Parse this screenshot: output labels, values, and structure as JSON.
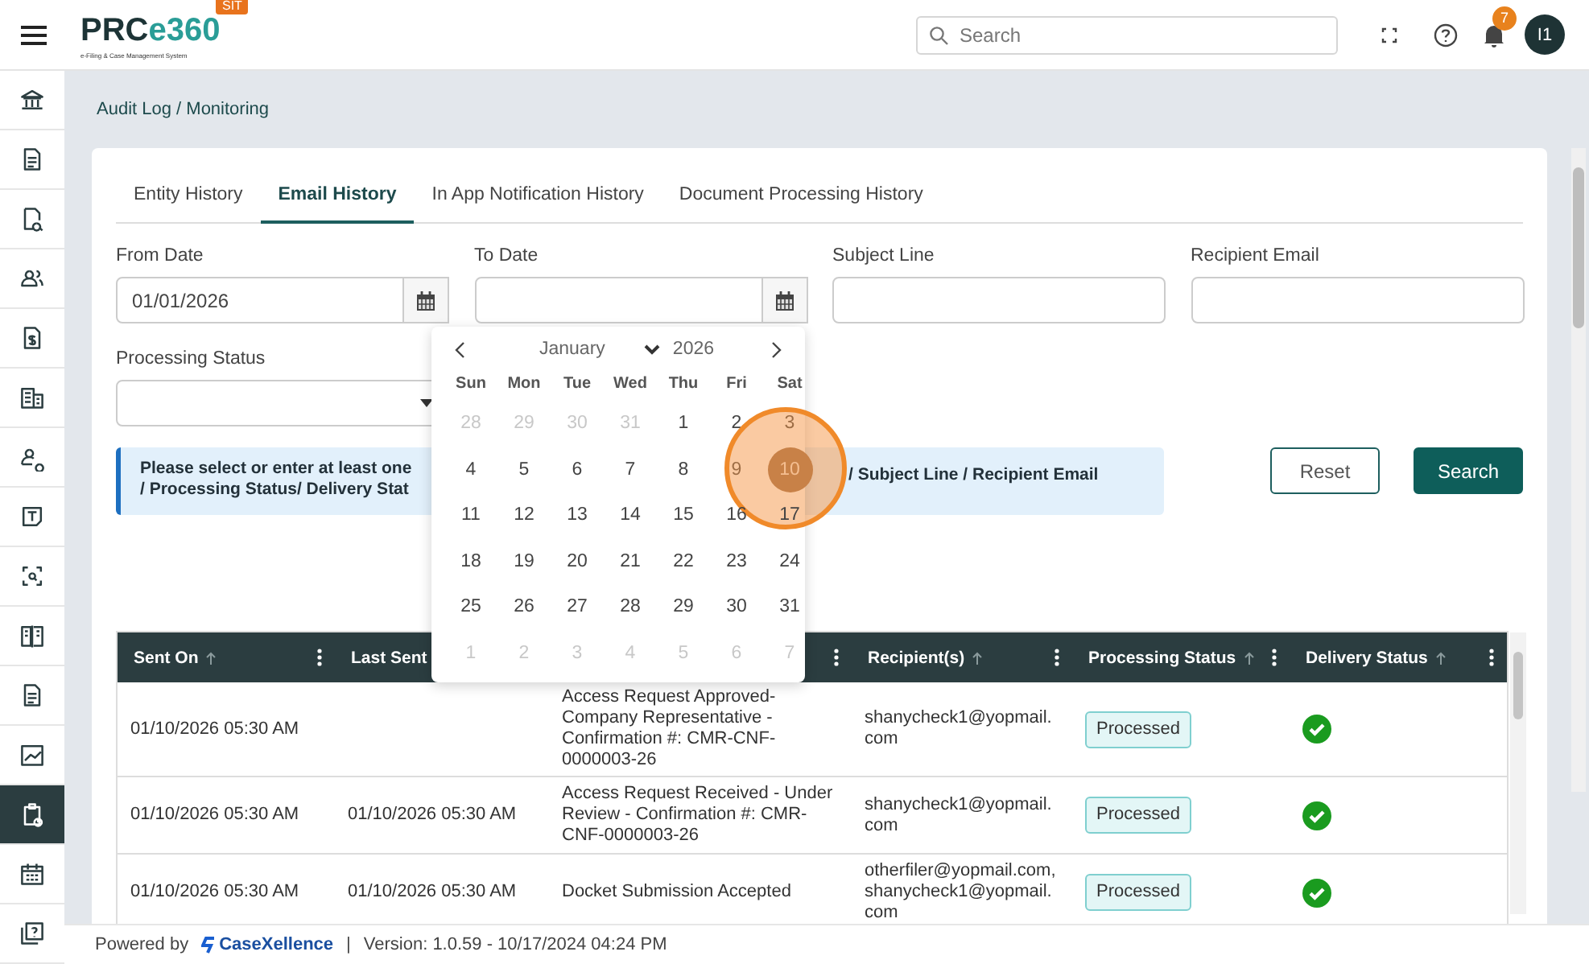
{
  "header": {
    "logo_main": "PRC",
    "logo_accent": "e360",
    "logo_subtitle": "e-Filing & Case Management System",
    "env_badge": "SIT",
    "search": {
      "placeholder": "Search"
    },
    "notification_count": "7",
    "avatar": "I1"
  },
  "sidebar": {
    "items": [
      {
        "selected": false
      },
      {
        "selected": false
      },
      {
        "selected": false
      },
      {
        "selected": false
      },
      {
        "selected": false
      },
      {
        "selected": false
      },
      {
        "selected": false
      },
      {
        "selected": false
      },
      {
        "selected": false
      },
      {
        "selected": false
      },
      {
        "selected": false
      },
      {
        "selected": false
      },
      {
        "selected": true
      },
      {
        "selected": false
      },
      {
        "selected": false
      }
    ]
  },
  "breadcrumb": "Audit Log / Monitoring",
  "tabs": [
    {
      "label": "Entity History",
      "selected": false
    },
    {
      "label": "Email History",
      "selected": true
    },
    {
      "label": "In App Notification History",
      "selected": false
    },
    {
      "label": "Document Processing History",
      "selected": false
    }
  ],
  "filters": [
    {
      "kind": "date",
      "label": "From Date",
      "value": "01/01/2026"
    },
    {
      "kind": "date",
      "label": "To Date"
    },
    {
      "kind": "text",
      "label": "Subject Line"
    },
    {
      "kind": "text",
      "label": "Recipient Email"
    },
    {
      "kind": "select",
      "label": "Processing Status"
    }
  ],
  "alert": {
    "line_1": "Please select or enter at least one",
    "line_2": "/ Processing Status/ Delivery Stat",
    "line_1_rest": "/ Subject Line / Recipient Email"
  },
  "buttons": [
    {
      "kind": "outline",
      "label": "Reset"
    },
    {
      "kind": "primary",
      "label": "Search"
    }
  ],
  "calendar": {
    "month": "January",
    "year": "2026",
    "weekdays": [
      "Sun",
      "Mon",
      "Tue",
      "Wed",
      "Thu",
      "Fri",
      "Sat"
    ],
    "weeks": [
      [
        {
          "day": "28",
          "outside": true,
          "selected": false
        },
        {
          "day": "29",
          "outside": true,
          "selected": false
        },
        {
          "day": "30",
          "outside": true,
          "selected": false
        },
        {
          "day": "31",
          "outside": true,
          "selected": false
        },
        {
          "day": "1",
          "outside": false,
          "selected": false
        },
        {
          "day": "2",
          "outside": false,
          "selected": false
        },
        {
          "day": "3",
          "outside": false,
          "selected": false
        }
      ],
      [
        {
          "day": "4",
          "outside": false,
          "selected": false
        },
        {
          "day": "5",
          "outside": false,
          "selected": false
        },
        {
          "day": "6",
          "outside": false,
          "selected": false
        },
        {
          "day": "7",
          "outside": false,
          "selected": false
        },
        {
          "day": "8",
          "outside": false,
          "selected": false
        },
        {
          "day": "9",
          "outside": false,
          "selected": false
        },
        {
          "day": "10",
          "outside": false,
          "selected": true
        }
      ],
      [
        {
          "day": "11",
          "outside": false,
          "selected": false
        },
        {
          "day": "12",
          "outside": false,
          "selected": false
        },
        {
          "day": "13",
          "outside": false,
          "selected": false
        },
        {
          "day": "14",
          "outside": false,
          "selected": false
        },
        {
          "day": "15",
          "outside": false,
          "selected": false
        },
        {
          "day": "16",
          "outside": false,
          "selected": false
        },
        {
          "day": "17",
          "outside": false,
          "selected": false
        }
      ],
      [
        {
          "day": "18",
          "outside": false,
          "selected": false
        },
        {
          "day": "19",
          "outside": false,
          "selected": false
        },
        {
          "day": "20",
          "outside": false,
          "selected": false
        },
        {
          "day": "21",
          "outside": false,
          "selected": false
        },
        {
          "day": "22",
          "outside": false,
          "selected": false
        },
        {
          "day": "23",
          "outside": false,
          "selected": false
        },
        {
          "day": "24",
          "outside": false,
          "selected": false
        }
      ],
      [
        {
          "day": "25",
          "outside": false,
          "selected": false
        },
        {
          "day": "26",
          "outside": false,
          "selected": false
        },
        {
          "day": "27",
          "outside": false,
          "selected": false
        },
        {
          "day": "28",
          "outside": false,
          "selected": false
        },
        {
          "day": "29",
          "outside": false,
          "selected": false
        },
        {
          "day": "30",
          "outside": false,
          "selected": false
        },
        {
          "day": "31",
          "outside": false,
          "selected": false
        }
      ],
      [
        {
          "day": "1",
          "outside": true,
          "selected": false
        },
        {
          "day": "2",
          "outside": true,
          "selected": false
        },
        {
          "day": "3",
          "outside": true,
          "selected": false
        },
        {
          "day": "4",
          "outside": true,
          "selected": false
        },
        {
          "day": "5",
          "outside": true,
          "selected": false
        },
        {
          "day": "6",
          "outside": true,
          "selected": false
        },
        {
          "day": "7",
          "outside": true,
          "selected": false
        }
      ]
    ]
  },
  "table": {
    "columns": [
      {
        "label": "Sent On",
        "sortable": true
      },
      {
        "label": "Last Sent"
      },
      {},
      {
        "label": "Recipient(s)",
        "sortable": true
      },
      {
        "label": "Processing Status",
        "sortable": true
      },
      {
        "label": "Delivery Status",
        "sortable": true
      }
    ],
    "rows": [
      {
        "sent_on": "01/10/2026 05:30 AM",
        "subject": "Access Request Approved-Company Representative - Confirmation #: CMR-CNF-0000003-26",
        "recipients": "shanycheck1@yopmail.com",
        "processing_status": "Processed",
        "delivered": true
      },
      {
        "sent_on": "01/10/2026 05:30 AM",
        "last_sent": "01/10/2026 05:30 AM",
        "subject": "Access Request Received - Under Review - Confirmation #: CMR-CNF-0000003-26",
        "recipients": "shanycheck1@yopmail.com",
        "processing_status": "Processed",
        "delivered": true
      },
      {
        "sent_on": "01/10/2026 05:30 AM",
        "last_sent": "01/10/2026 05:30 AM",
        "subject": "Docket Submission Accepted",
        "recipients": "otherfiler@yopmail.com,shanycheck1@yopmail.com",
        "processing_status": "Processed",
        "delivered": true
      }
    ]
  },
  "footer": {
    "powered_by": "Powered by",
    "brand": "CaseXellence",
    "separator": "|",
    "version": "Version: 1.0.59 - 10/17/2024 04:24 PM"
  }
}
